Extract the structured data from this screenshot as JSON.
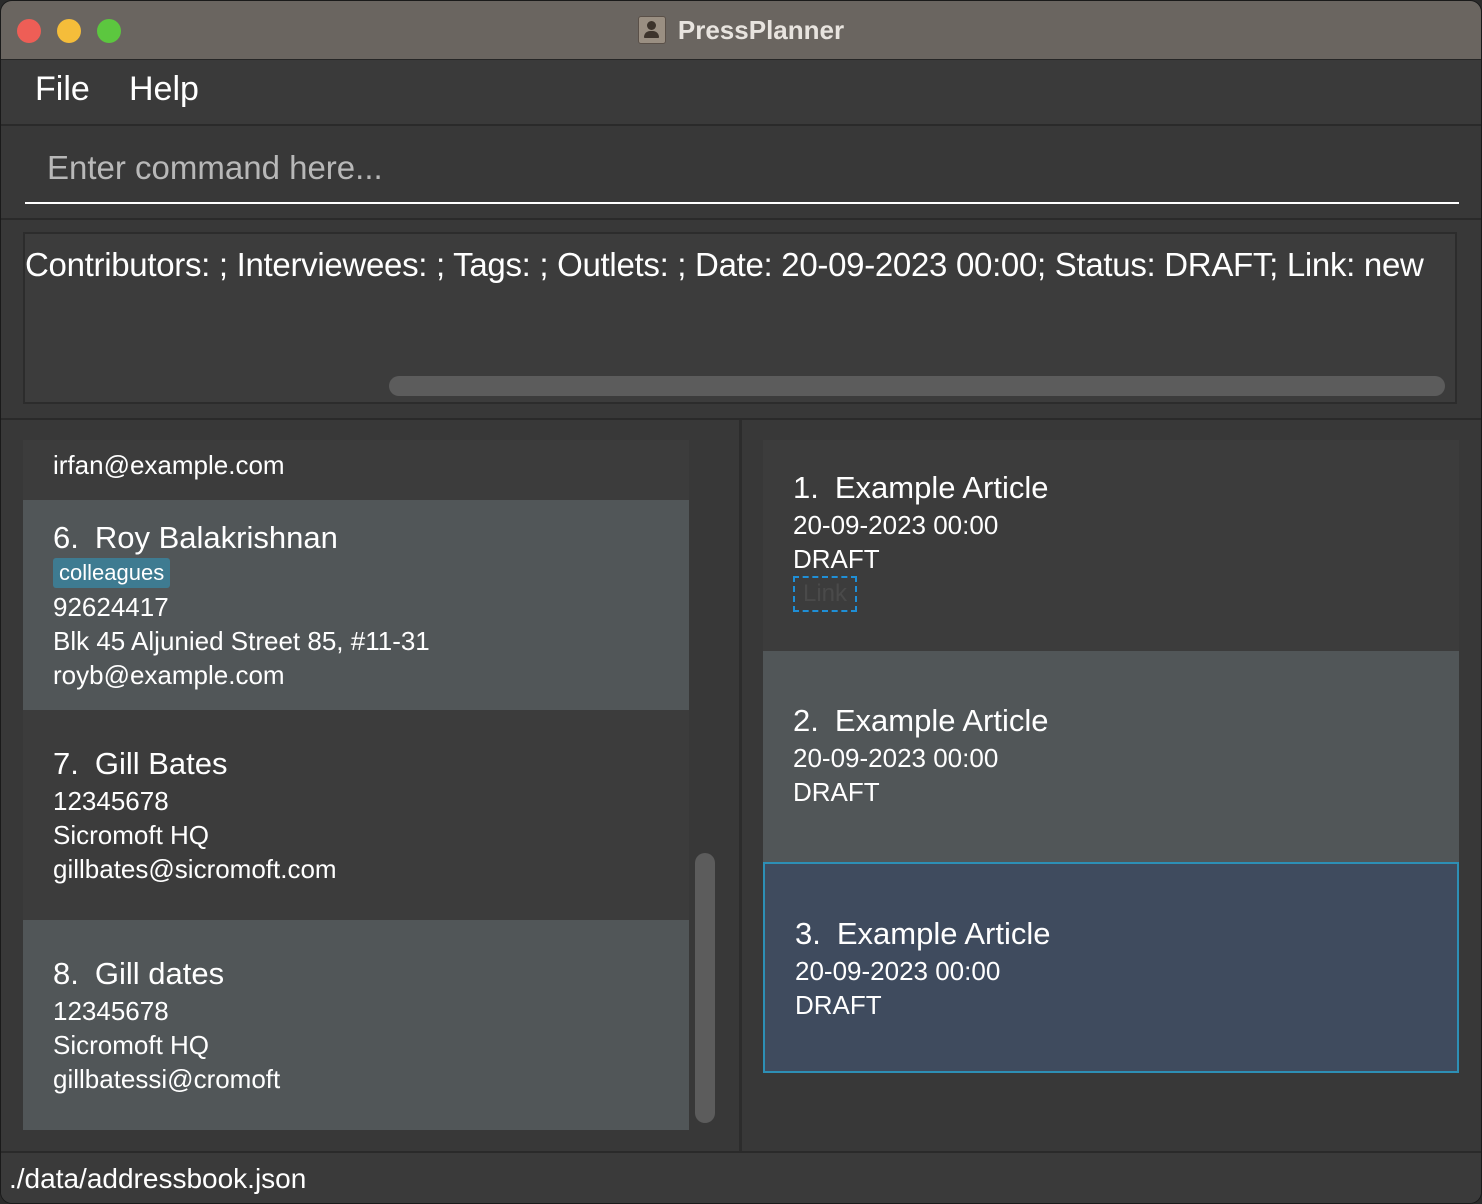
{
  "window": {
    "title": "PressPlanner",
    "app_icon": "contacts-app-icon"
  },
  "menu": {
    "file": "File",
    "help": "Help"
  },
  "command": {
    "placeholder": "Enter command here...",
    "value": ""
  },
  "result": {
    "text": "Contributors: ; Interviewees: ; Tags: ; Outlets: ; Date: 20-09-2023 00:00; Status: DRAFT; Link: new"
  },
  "persons": {
    "partial": {
      "cut_text": "irfan@example.com"
    },
    "items": [
      {
        "index": "6.",
        "name": "Roy Balakrishnan",
        "tag": "colleagues",
        "phone": "92624417",
        "address": "Blk 45 Aljunied Street 85, #11-31",
        "email": "royb@example.com"
      },
      {
        "index": "7.",
        "name": "Gill Bates",
        "phone": "12345678",
        "address": "Sicromoft HQ",
        "email": "gillbates@sicromoft.com"
      },
      {
        "index": "8.",
        "name": "Gill dates",
        "phone": "12345678",
        "address": "Sicromoft HQ",
        "email": "gillbatessi@cromoft"
      }
    ]
  },
  "articles": {
    "items": [
      {
        "index": "1.",
        "title": "Example Article",
        "date": "20-09-2023 00:00",
        "status": "DRAFT",
        "link": "Link"
      },
      {
        "index": "2.",
        "title": "Example Article",
        "date": "20-09-2023 00:00",
        "status": "DRAFT"
      },
      {
        "index": "3.",
        "title": "Example Article",
        "date": "20-09-2023 00:00",
        "status": "DRAFT"
      }
    ]
  },
  "status_bar": {
    "path": "./data/addressbook.json"
  },
  "colors": {
    "titlebar": "#6a6560",
    "tag_bg": "#3e7b91",
    "selected_bg": "#3f4b5e",
    "selected_border": "#2d8fb5",
    "link_border": "#1f8fd6"
  }
}
